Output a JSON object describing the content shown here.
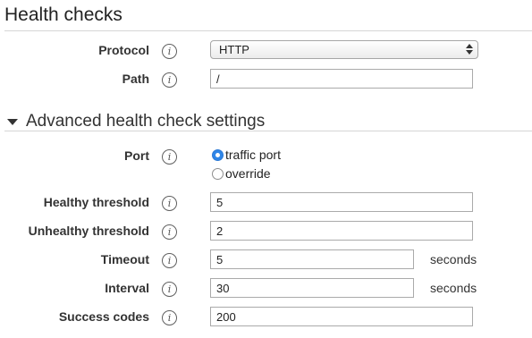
{
  "section": {
    "title": "Health checks"
  },
  "fields": {
    "protocol": {
      "label": "Protocol",
      "value": "HTTP"
    },
    "path": {
      "label": "Path",
      "value": "/"
    }
  },
  "advanced": {
    "title": "Advanced health check settings",
    "port": {
      "label": "Port",
      "options": [
        {
          "label": "traffic port",
          "selected": true
        },
        {
          "label": "override",
          "selected": false
        }
      ]
    },
    "healthy_threshold": {
      "label": "Healthy threshold",
      "value": "5"
    },
    "unhealthy_threshold": {
      "label": "Unhealthy threshold",
      "value": "2"
    },
    "timeout": {
      "label": "Timeout",
      "value": "5",
      "unit": "seconds"
    },
    "interval": {
      "label": "Interval",
      "value": "30",
      "unit": "seconds"
    },
    "success_codes": {
      "label": "Success codes",
      "value": "200"
    }
  },
  "icons": {
    "info_glyph": "i",
    "info": "info-icon",
    "toggle": "caret-down-icon",
    "select_arrows": "select-arrows-icon"
  },
  "colors": {
    "radio_selected": "#2f86e8",
    "input_border": "#aaaaaa",
    "divider": "#d5d5d5"
  }
}
